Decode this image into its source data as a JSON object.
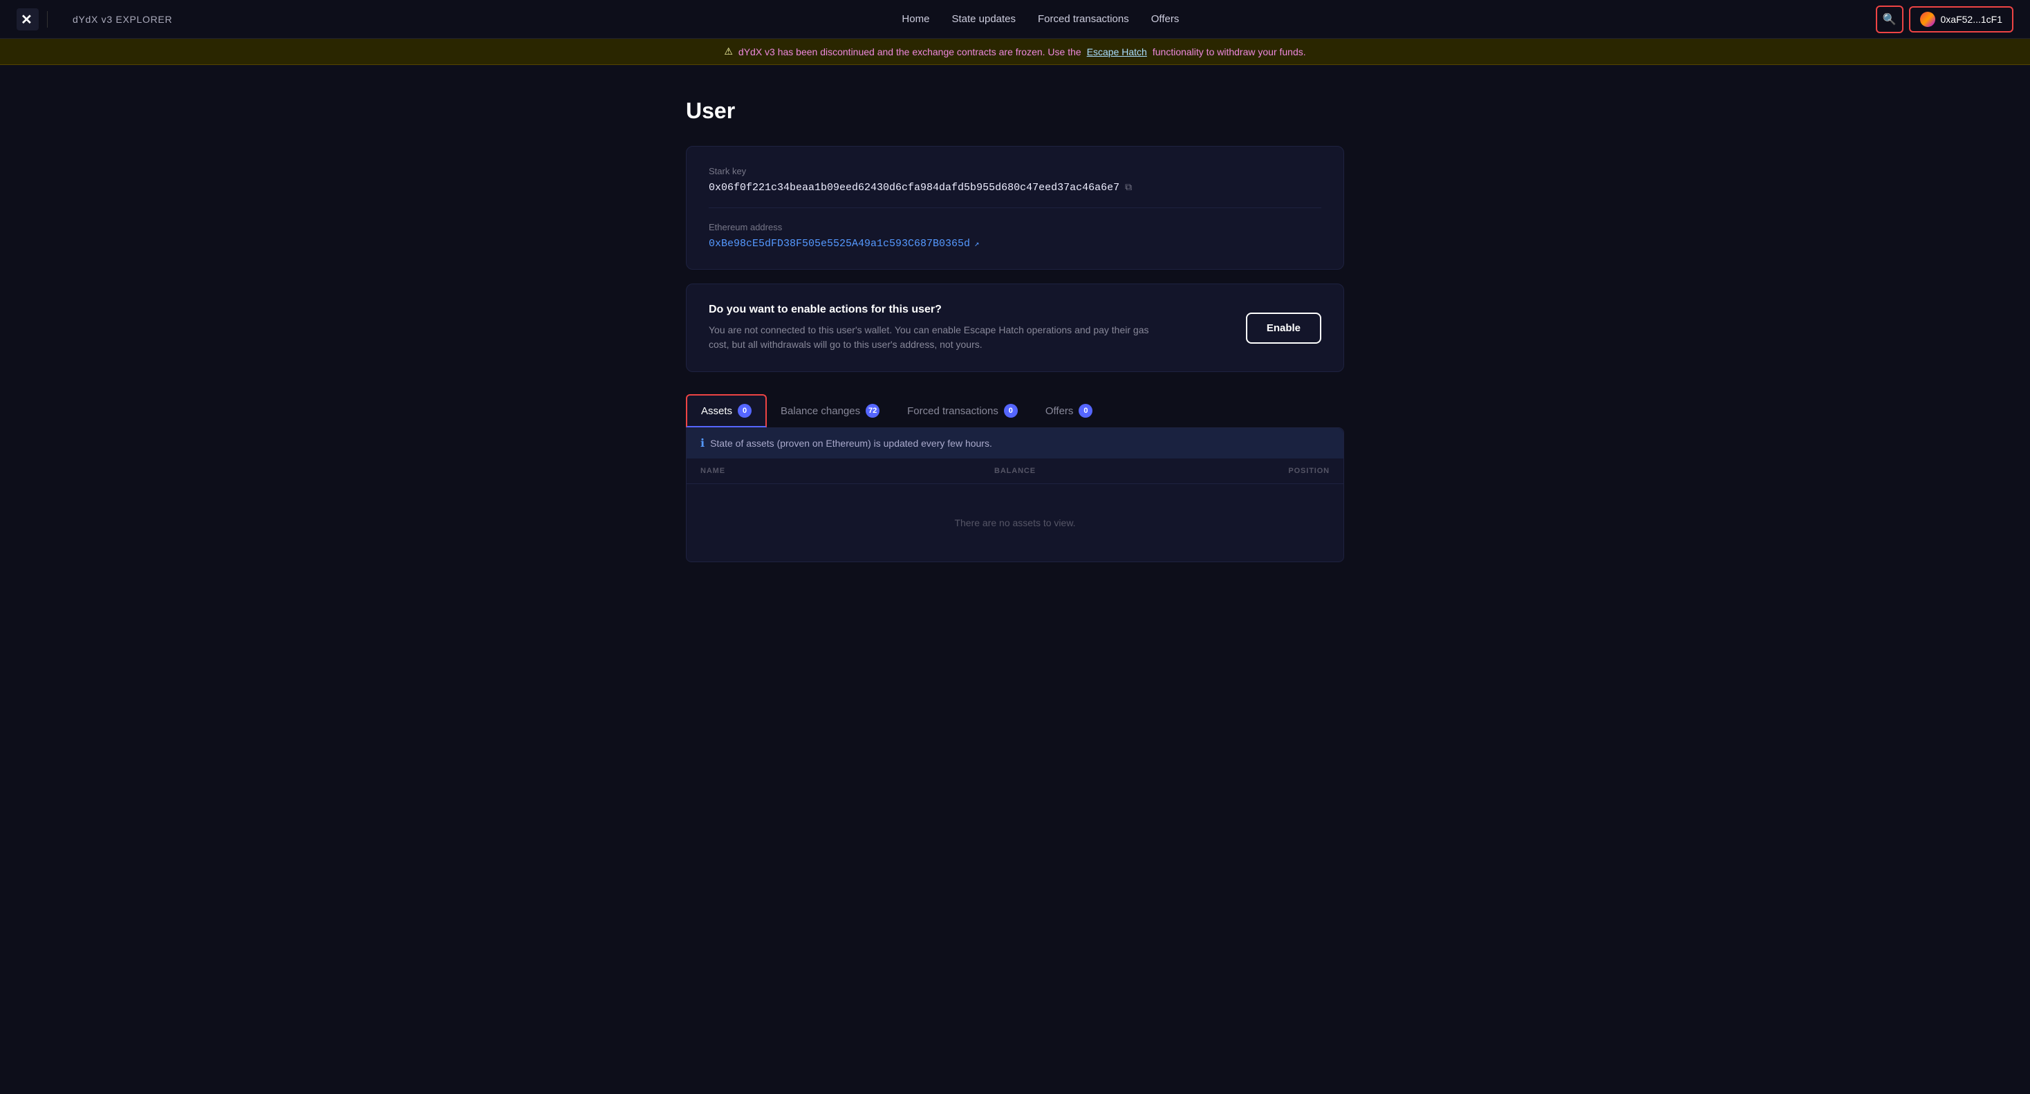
{
  "navbar": {
    "logo_text": "X",
    "title": "dYdX v3 EXPLORER",
    "links": [
      {
        "label": "Home",
        "id": "home"
      },
      {
        "label": "State updates",
        "id": "state-updates"
      },
      {
        "label": "Forced transactions",
        "id": "forced-transactions"
      },
      {
        "label": "Offers",
        "id": "offers"
      }
    ],
    "wallet_address": "0xaF52...1cF1"
  },
  "banner": {
    "icon": "⚠",
    "text_before": "dYdX v3 has been discontinued and the exchange contracts are frozen. Use the",
    "link_text": "Escape Hatch",
    "text_after": "functionality to withdraw your funds."
  },
  "page": {
    "title": "User"
  },
  "stark_key": {
    "label": "Stark key",
    "value": "0x06f0f221c34beaa1b09eed62430d6cfa984dafd5b955d680c47eed37ac46a6e7"
  },
  "ethereum_address": {
    "label": "Ethereum address",
    "value": "0xBe98cE5dFD38F505e5525A49a1c593C687B0365d"
  },
  "enable_card": {
    "title": "Do you want to enable actions for this user?",
    "description": "You are not connected to this user's wallet. You can enable Escape Hatch operations and pay their gas cost, but all withdrawals will go to this user's address, not yours.",
    "button_label": "Enable"
  },
  "tabs": [
    {
      "label": "Assets",
      "count": "0",
      "active": true,
      "id": "assets"
    },
    {
      "label": "Balance changes",
      "count": "72",
      "active": false,
      "id": "balance-changes"
    },
    {
      "label": "Forced transactions",
      "count": "0",
      "active": false,
      "id": "forced-transactions"
    },
    {
      "label": "Offers",
      "count": "0",
      "active": false,
      "id": "offers"
    }
  ],
  "info_bar": {
    "text": "State of assets (proven on Ethereum) is updated every few hours."
  },
  "table": {
    "headers": [
      "NAME",
      "BALANCE",
      "POSITION"
    ],
    "empty_text": "There are no assets to view."
  }
}
